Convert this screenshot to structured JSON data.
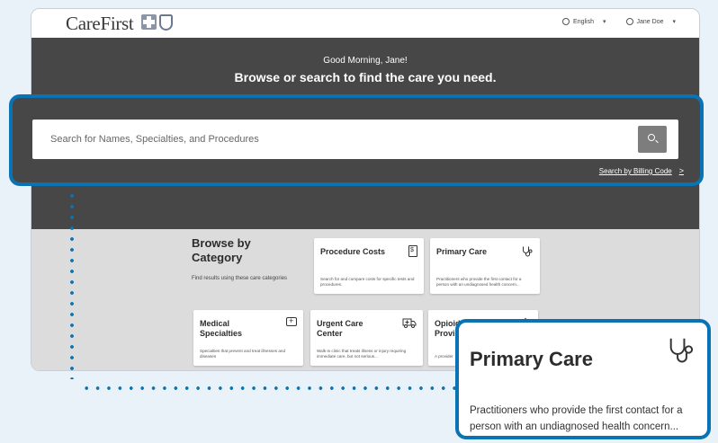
{
  "header": {
    "logo_text": "CareFirst",
    "language_label": "English",
    "user_label": "Jane Doe"
  },
  "hero": {
    "greeting": "Good Morning, Jane!",
    "headline": "Browse or search to find the care you need."
  },
  "search": {
    "placeholder": "Search for Names, Specialties, and Procedures",
    "billing_link": "Search by Billing Code",
    "billing_chevron": ">"
  },
  "browse": {
    "title": "Browse by Category",
    "subtitle": "Find results using these care categories",
    "cards": [
      {
        "title": "Procedure Costs",
        "desc": "Search for and compare costs for specific tests and procedures.",
        "icon": "dollar-document-icon"
      },
      {
        "title": "Primary Care",
        "desc": "Practitioners who provide the first contact for a person with an undiagnosed health concern...",
        "icon": "stethoscope-icon"
      },
      {
        "title": "Medical Specialties",
        "desc": "Specialties that prevent and treat illnesses and diseases",
        "icon": "medical-kit-icon"
      },
      {
        "title": "Urgent Care Center",
        "desc": "Walk-in clinic that treats illness or injury requiring immediate care, but not serious...",
        "icon": "ambulance-icon"
      },
      {
        "title": "Opioid Treatment Provid",
        "desc": "A provider",
        "icon": "pill-icon"
      }
    ]
  },
  "zoom_card": {
    "title": "Primary Care",
    "desc_line1": "Practitioners who provide the first contact for a",
    "desc_line2": "person with an undiagnosed health concern..."
  },
  "colors": {
    "accent": "#0a73b3",
    "hero_bg": "#474747",
    "browse_bg": "#dcdcdc",
    "page_bg": "#e9f1f9"
  }
}
